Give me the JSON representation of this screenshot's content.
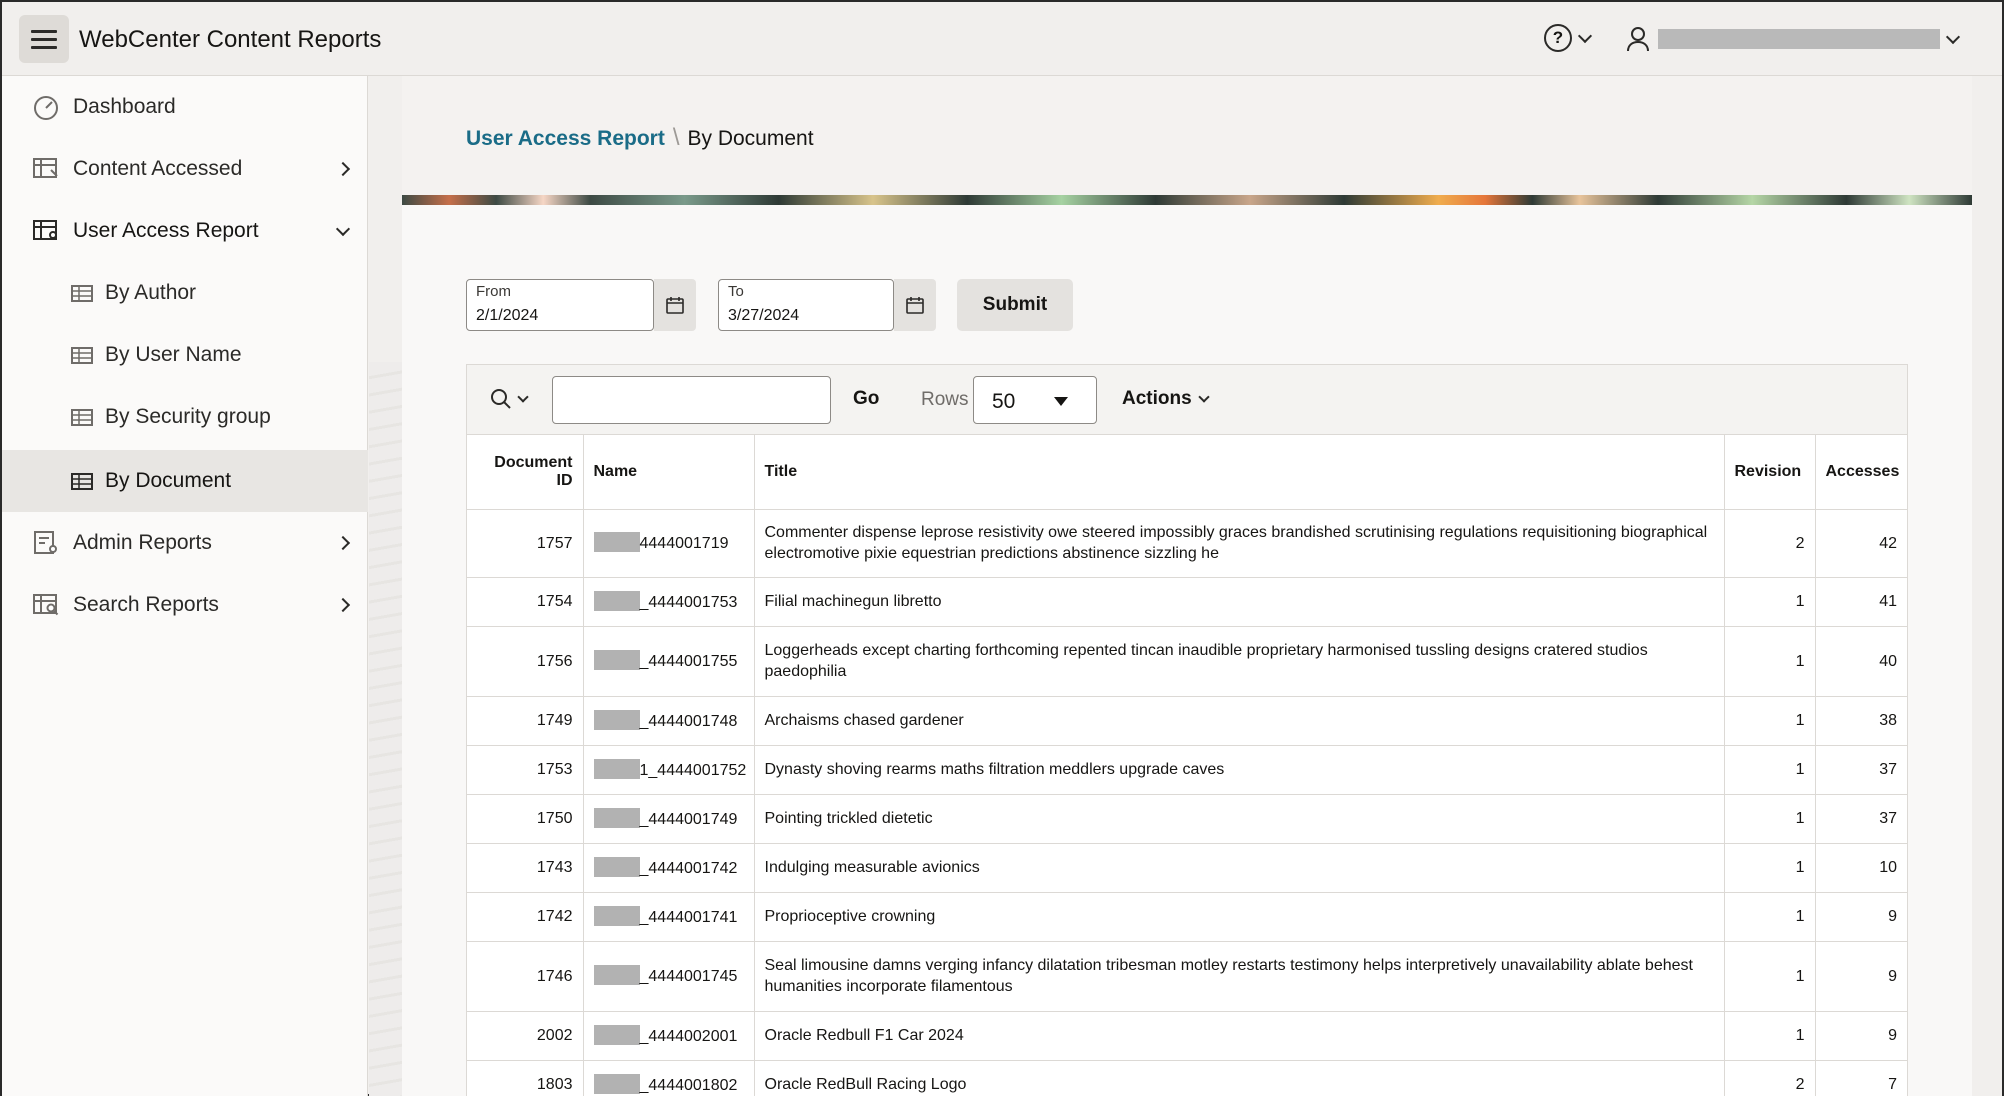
{
  "app": {
    "title": "WebCenter Content Reports"
  },
  "header": {
    "help_icon": "help-icon",
    "user_icon": "user-icon"
  },
  "sidebar": {
    "items": [
      {
        "label": "Dashboard",
        "icon": "dashboard-gauge-icon"
      },
      {
        "label": "Content Accessed",
        "icon": "report-table-icon",
        "expandable": true
      },
      {
        "label": "User Access Report",
        "icon": "report-user-icon",
        "expanded": true
      },
      {
        "label": "By Author",
        "icon": "table-icon",
        "child": true
      },
      {
        "label": "By User Name",
        "icon": "table-icon",
        "child": true
      },
      {
        "label": "By Security group",
        "icon": "table-icon",
        "child": true
      },
      {
        "label": "By Document",
        "icon": "table-icon",
        "child": true,
        "selected": true
      },
      {
        "label": "Admin Reports",
        "icon": "admin-report-icon",
        "expandable": true
      },
      {
        "label": "Search Reports",
        "icon": "search-report-icon",
        "expandable": true
      }
    ]
  },
  "breadcrumb": {
    "parent": "User Access Report",
    "separator": "\\",
    "current": "By Document"
  },
  "filters": {
    "from_label": "From",
    "from_value": "2/1/2024",
    "to_label": "To",
    "to_value": "3/27/2024",
    "submit_label": "Submit"
  },
  "toolbar": {
    "search_value": "",
    "go_label": "Go",
    "rows_label": "Rows",
    "rows_value": "50",
    "actions_label": "Actions"
  },
  "table": {
    "columns": [
      "Document ID",
      "Name",
      "Title",
      "Revision",
      "Accesses"
    ],
    "rows": [
      {
        "id": "1757",
        "name": "4444001719",
        "title": "Commenter dispense leprose resistivity owe steered impossibly graces brandished scrutinising regulations requisitioning biographical electromotive pixie equestrian predictions abstinence sizzling he",
        "revision": "2",
        "accesses": "42"
      },
      {
        "id": "1754",
        "name": "_4444001753",
        "title": "Filial machinegun libretto",
        "revision": "1",
        "accesses": "41"
      },
      {
        "id": "1756",
        "name": "_4444001755",
        "title": "Loggerheads except charting forthcoming repented tincan inaudible proprietary harmonised tussling designs cratered studios paedophilia",
        "revision": "1",
        "accesses": "40"
      },
      {
        "id": "1749",
        "name": "_4444001748",
        "title": "Archaisms chased gardener",
        "revision": "1",
        "accesses": "38"
      },
      {
        "id": "1753",
        "name": "1_4444001752",
        "title": "Dynasty shoving rearms maths filtration meddlers upgrade caves",
        "revision": "1",
        "accesses": "37"
      },
      {
        "id": "1750",
        "name": "_4444001749",
        "title": "Pointing trickled dietetic",
        "revision": "1",
        "accesses": "37"
      },
      {
        "id": "1743",
        "name": "_4444001742",
        "title": "Indulging measurable avionics",
        "revision": "1",
        "accesses": "10"
      },
      {
        "id": "1742",
        "name": "_4444001741",
        "title": "Proprioceptive crowning",
        "revision": "1",
        "accesses": "9"
      },
      {
        "id": "1746",
        "name": "_4444001745",
        "title": "Seal limousine damns verging infancy dilatation tribesman motley restarts testimony helps interpretively unavailability ablate behest humanities incorporate filamentous",
        "revision": "1",
        "accesses": "9"
      },
      {
        "id": "2002",
        "name": "_4444002001",
        "title": "Oracle Redbull F1 Car 2024",
        "revision": "1",
        "accesses": "9"
      },
      {
        "id": "1803",
        "name": "_4444001802",
        "title": "Oracle RedBull Racing Logo",
        "revision": "2",
        "accesses": "7"
      }
    ]
  }
}
